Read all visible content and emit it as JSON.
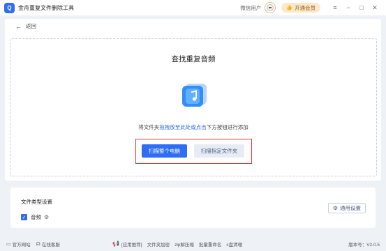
{
  "titlebar": {
    "app_title": "金舟重复文件删除工具",
    "user_name": "微信用户",
    "vip_label": "开通会员",
    "menu_glyph": "≡",
    "minimize_glyph": "−",
    "maximize_glyph": "□",
    "close_glyph": "✕",
    "logo_text": "Q"
  },
  "nav": {
    "back_label": "返回"
  },
  "main": {
    "heading": "查找重复音频",
    "hint_prefix": "将文件夹",
    "hint_link": "拖拽放至此处或点击",
    "hint_suffix": "下方按钮进行添加",
    "scan_pc_label": "扫描整个电脑",
    "scan_folder_label": "扫描指定文件夹"
  },
  "settings": {
    "title": "文件类型设置",
    "type_audio": "音频",
    "general_settings_label": "通用设置"
  },
  "footer": {
    "official_site": "官方网站",
    "online_service": "在线客服",
    "recommend_label": "[应用推荐]",
    "apps": [
      "文件夹加密",
      "zip解压缩",
      "批量重命名",
      "c盘清理"
    ],
    "version": "版本号：V2.0.5"
  },
  "colors": {
    "accent": "#2f6ef0",
    "highlight_border": "#e03a3a",
    "vip_bg": "#fde8c9"
  }
}
